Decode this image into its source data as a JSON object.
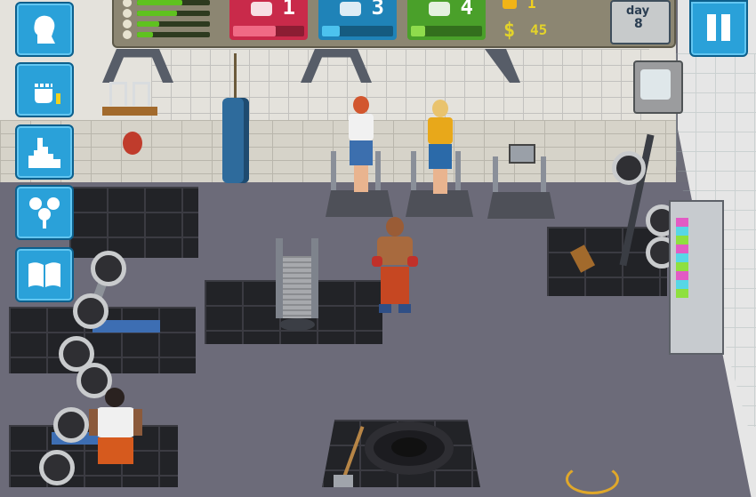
{
  "hud": {
    "energy_bars": [
      {
        "icon": "strength-icon",
        "level": 0.62
      },
      {
        "icon": "speed-icon",
        "level": 0.55
      },
      {
        "icon": "mood-icon",
        "level": 0.3
      },
      {
        "icon": "energy-icon",
        "level": 0.22
      }
    ],
    "stats": [
      {
        "name": "strength",
        "icon": "kettlebell-icon",
        "value": "1",
        "color": "#c92a4a",
        "level": 0.6
      },
      {
        "name": "agility",
        "icon": "sneaker-icon",
        "value": "3",
        "color": "#1f83b8",
        "level": 0.25
      },
      {
        "name": "stamina",
        "icon": "shoe-icon",
        "value": "4",
        "color": "#4aa02a",
        "level": 0.2
      }
    ],
    "coins": "1",
    "money": "45",
    "day_label": "day",
    "day_number": "8"
  },
  "side_menu": [
    {
      "name": "character",
      "icon": "boxer-profile-icon"
    },
    {
      "name": "training",
      "icon": "fist-icon"
    },
    {
      "name": "city",
      "icon": "city-icon"
    },
    {
      "name": "skills",
      "icon": "skill-tree-icon"
    },
    {
      "name": "journal",
      "icon": "book-icon"
    }
  ],
  "colors": {
    "menu_blue": "#2aa1d9",
    "money_yellow": "#e3d32a",
    "bar_green": "#5fc21f"
  }
}
